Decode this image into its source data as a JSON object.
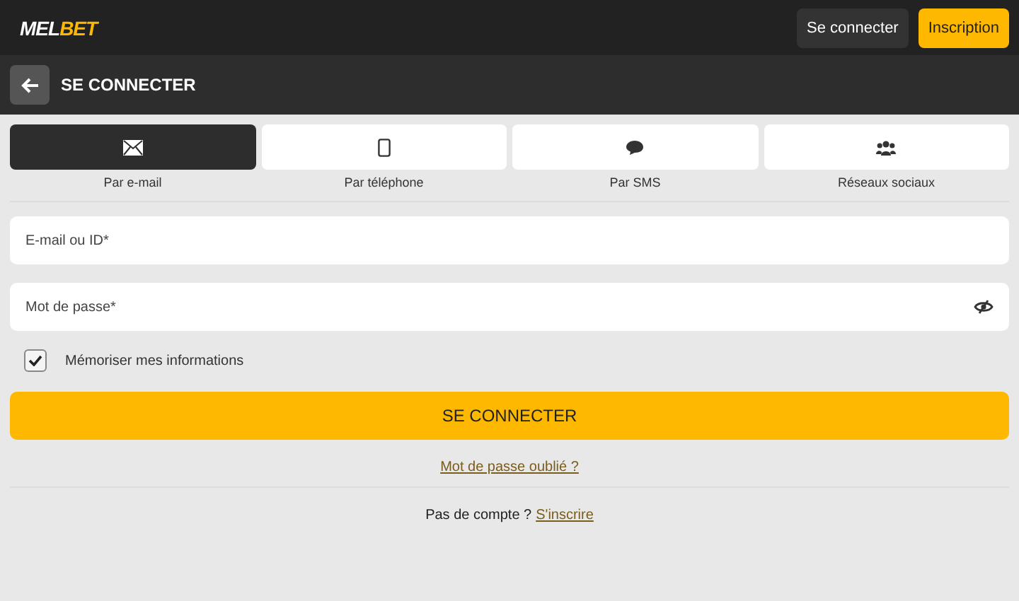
{
  "header": {
    "logo": {
      "parts": [
        "MEL",
        "BET"
      ]
    },
    "buttons": [
      {
        "label": "Se connecter",
        "kind": "dark"
      },
      {
        "label": "Inscription",
        "kind": "accent"
      }
    ]
  },
  "page_title": "SE CONNECTER",
  "tabs": [
    {
      "kind": "email",
      "label": "Par e-mail",
      "selected": true
    },
    {
      "kind": "phone",
      "label": "Par téléphone",
      "selected": false
    },
    {
      "kind": "sms",
      "label": "Par SMS",
      "selected": false
    },
    {
      "kind": "social",
      "label": "Réseaux sociaux",
      "selected": false
    }
  ],
  "fields": [
    {
      "placeholder": "E-mail ou ID*",
      "kind": "text"
    },
    {
      "placeholder": "Mot de passe*",
      "kind": "password"
    }
  ],
  "remember": {
    "label": "Mémoriser mes informations",
    "checked": true
  },
  "submit": "SE CONNECTER",
  "forgot_link": "Mot de passe oublié ?",
  "signup": {
    "text": "Pas de compte ?",
    "link": "S'inscrire"
  }
}
